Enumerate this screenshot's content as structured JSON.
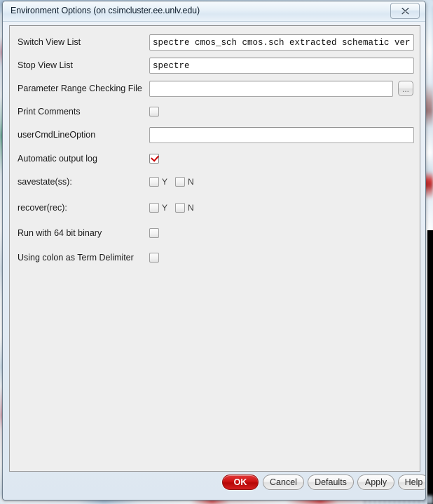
{
  "window": {
    "title": "Environment Options (on csimcluster.ee.unlv.edu)",
    "close_icon": "close-icon",
    "close_label": "X"
  },
  "form": {
    "fields": [
      {
        "label": "Switch View List",
        "value": "spectre cmos_sch cmos.sch extracted schematic veriloga"
      },
      {
        "label": "Stop View List",
        "value": "spectre"
      },
      {
        "label": "Parameter Range Checking File",
        "value": "",
        "browse_label": "..."
      },
      {
        "label": "Print Comments",
        "checked": false
      },
      {
        "label": "userCmdLineOption",
        "value": ""
      },
      {
        "label": "Automatic output log",
        "checked": true
      },
      {
        "label": "savestate(ss):",
        "yes_label": "Y",
        "no_label": "N",
        "yes": false,
        "no": false
      },
      {
        "label": "recover(rec):",
        "yes_label": "Y",
        "no_label": "N",
        "yes": false,
        "no": false
      },
      {
        "label": "Run with 64 bit binary",
        "checked": false
      },
      {
        "label": "Using colon as Term Delimiter",
        "checked": false
      }
    ]
  },
  "buttons": {
    "ok": "OK",
    "cancel": "Cancel",
    "defaults": "Defaults",
    "apply": "Apply",
    "help": "Help"
  },
  "colors": {
    "accent_red": "#cc1111",
    "check_red": "#cc0000",
    "dialog_bg": "#eeeeee",
    "titlebar": "#e8f1f8"
  }
}
